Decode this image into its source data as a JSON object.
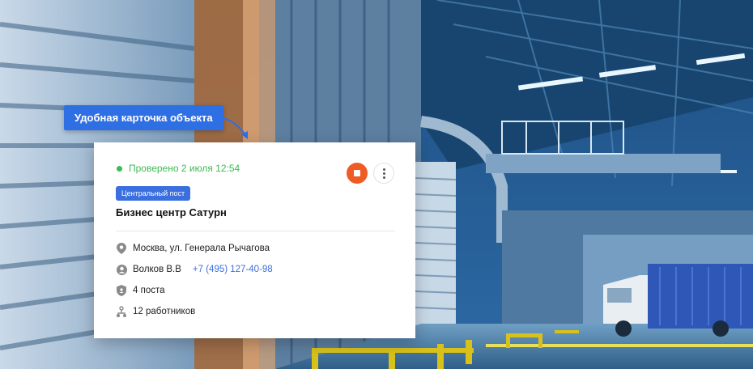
{
  "callout": {
    "label": "Удобная карточка объекта"
  },
  "card": {
    "status_text": "Проверено 2 июля 12:54",
    "badge": "Центральный пост",
    "title": "Бизнес центр Сатурн",
    "address": "Москва, ул. Генерала Рычагова",
    "contact_name": "Волков В.В",
    "contact_phone": "+7 (495) 127-40-98",
    "posts": "4 поста",
    "workers": "12 работников"
  },
  "colors": {
    "accent": "#2f6fe4",
    "status_green": "#3dbb54",
    "stop_orange": "#ef5b24",
    "phone_blue": "#3b6fe0"
  },
  "icons": [
    "location-pin-icon",
    "person-icon",
    "shield-icon",
    "workers-icon",
    "stop-icon",
    "more-vertical-icon",
    "arrow-icon"
  ]
}
